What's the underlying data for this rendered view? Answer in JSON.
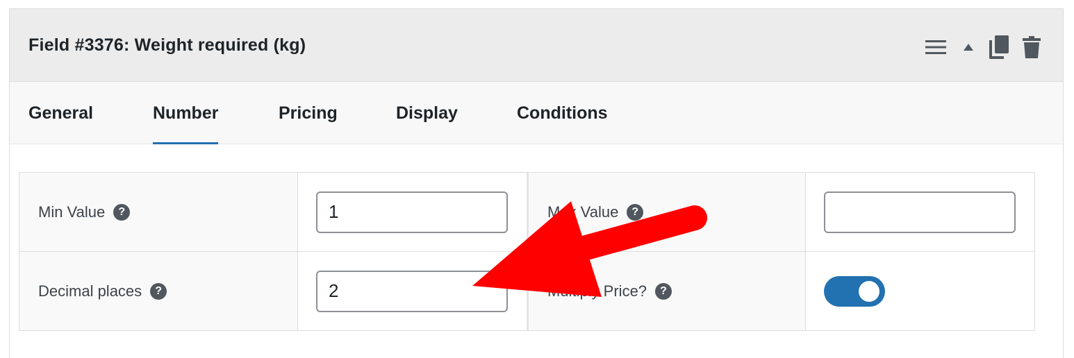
{
  "field": {
    "title": "Field #3376: Weight required (kg)",
    "actions": [
      "menu-icon",
      "collapse-arrow-icon",
      "copy-icon",
      "trash-icon"
    ]
  },
  "tabs": [
    {
      "label": "General",
      "active": false
    },
    {
      "label": "Number",
      "active": true
    },
    {
      "label": "Pricing",
      "active": false
    },
    {
      "label": "Display",
      "active": false
    },
    {
      "label": "Conditions",
      "active": false
    }
  ],
  "number_settings": {
    "min_value": {
      "label": "Min Value",
      "help": "?",
      "value": "1"
    },
    "max_value": {
      "label": "Max Value",
      "help": "?",
      "value": ""
    },
    "decimal_places": {
      "label": "Decimal places",
      "help": "?",
      "value": "2"
    },
    "multiply_price": {
      "label": "Multiply Price?",
      "help": "?",
      "enabled": true
    }
  },
  "colors": {
    "accent": "#2271b1",
    "annotation_arrow": "#ff0000",
    "header_bg": "#ececec"
  },
  "annotation": {
    "icon": "red-arrow-annotation"
  }
}
